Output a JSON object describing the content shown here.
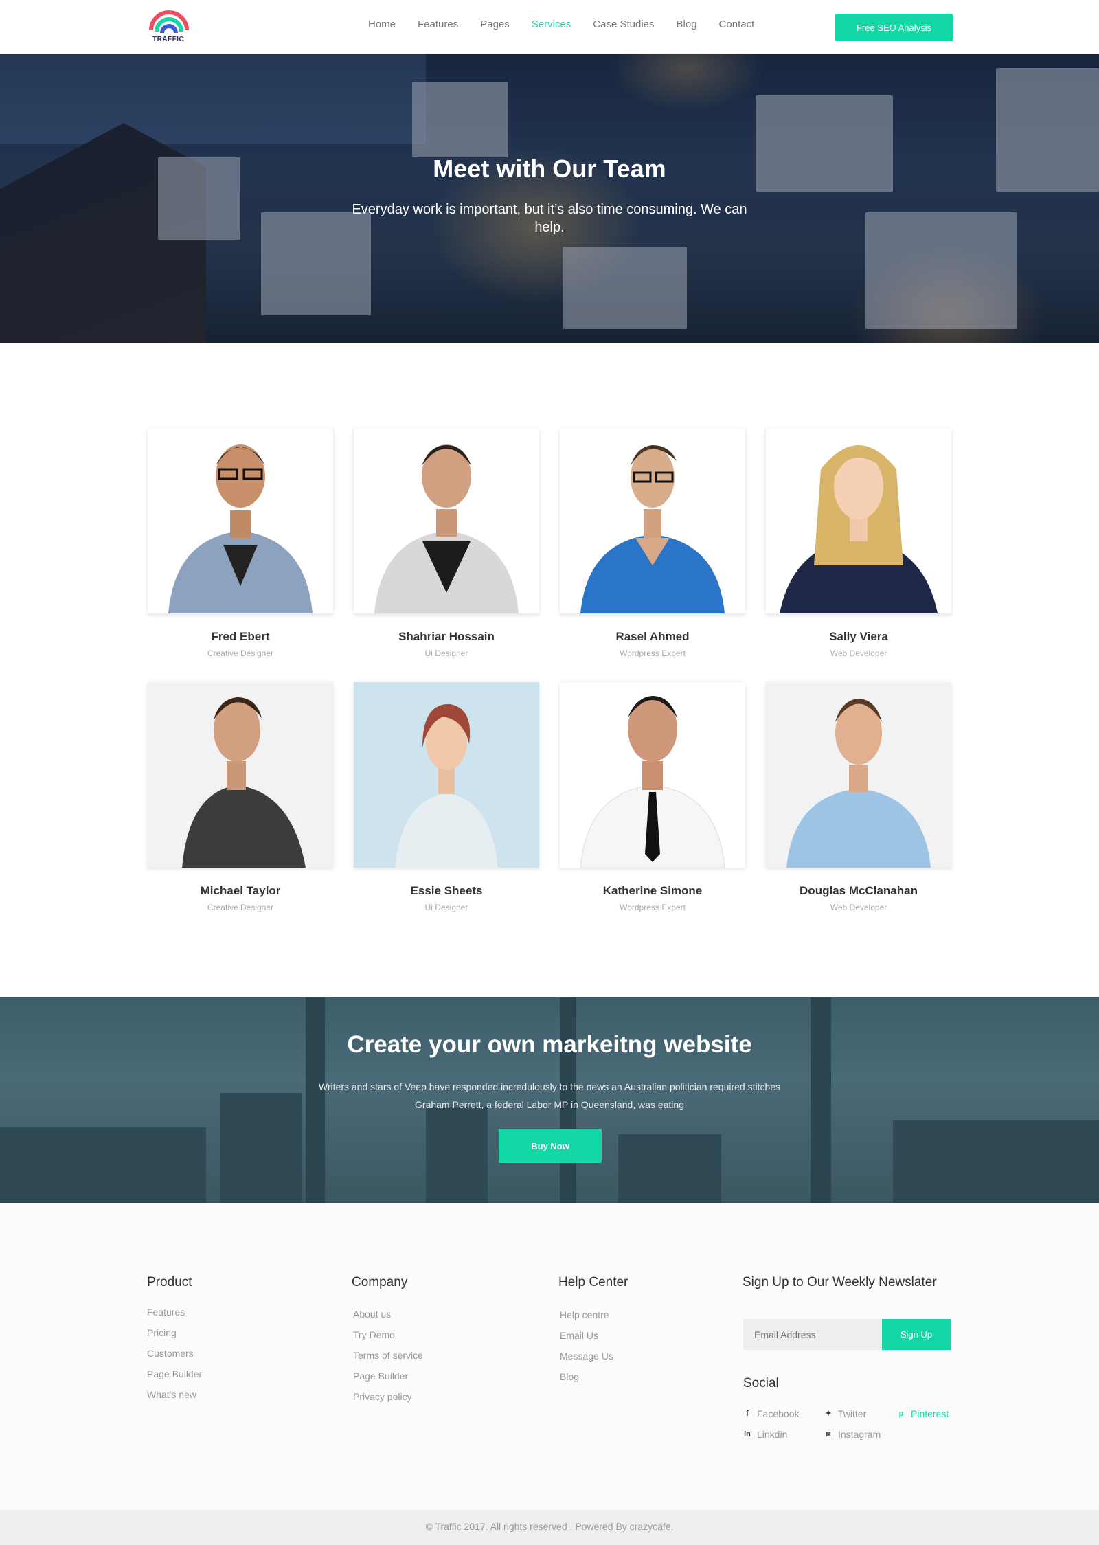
{
  "header": {
    "logo_text": "TRAFFIC",
    "nav": [
      "Home",
      "Features",
      "Pages",
      "Services",
      "Case Studies",
      "Blog",
      "Contact"
    ],
    "active_nav": "Services",
    "cta_label": "Free SEO Analysis"
  },
  "hero": {
    "title": "Meet with Our Team",
    "subtitle": "Everyday work is important, but it’s also time consuming. We can help."
  },
  "team": [
    {
      "name": "Fred Ebert",
      "role": "Creative Designer"
    },
    {
      "name": "Shahriar Hossain",
      "role": "Ui Designer"
    },
    {
      "name": "Rasel Ahmed",
      "role": "Wordpress Expert"
    },
    {
      "name": "Sally Viera",
      "role": "Web Developer"
    },
    {
      "name": "Michael Taylor",
      "role": "Creative Designer"
    },
    {
      "name": "Essie Sheets",
      "role": "Ui Designer"
    },
    {
      "name": "Katherine Simone",
      "role": "Wordpress Expert"
    },
    {
      "name": "Douglas McClanahan",
      "role": "Web Developer"
    }
  ],
  "banner": {
    "title": "Create your own markeitng website",
    "text_line1": "Writers and stars of Veep have responded incredulously to the news an Australian politician required stitches",
    "text_line2": "Graham Perrett, a federal Labor MP in Queensland, was eating",
    "button": "Buy Now"
  },
  "footer": {
    "product": {
      "title": "Product",
      "links": [
        "Features",
        "Pricing",
        "Customers",
        "Page Builder",
        "What's new"
      ]
    },
    "company": {
      "title": "Company",
      "links": [
        "About us",
        "Try Demo",
        "Terms of service",
        "Page Builder",
        "Privacy policy"
      ]
    },
    "help": {
      "title": "Help Center",
      "links": [
        "Help centre",
        "Email Us",
        "Message Us",
        "Blog"
      ]
    },
    "newsletter": {
      "title": "Sign Up to Our Weekly Newslater",
      "placeholder": "Email Address",
      "button": "Sign Up"
    },
    "social": {
      "title": "Social",
      "links": [
        {
          "label": "Facebook",
          "icon": "facebook-icon"
        },
        {
          "label": "Twitter",
          "icon": "twitter-icon"
        },
        {
          "label": "Pinterest",
          "icon": "pinterest-icon"
        },
        {
          "label": "Linkdin",
          "icon": "linkedin-icon"
        },
        {
          "label": "Instagram",
          "icon": "instagram-icon"
        }
      ]
    },
    "copyright": "© Traffic 2017. All rights reserved . Powered By crazycafe."
  },
  "colors": {
    "accent": "#13d8a6",
    "nav_active": "#1ed3a5",
    "banner": "#3d5d6a"
  }
}
